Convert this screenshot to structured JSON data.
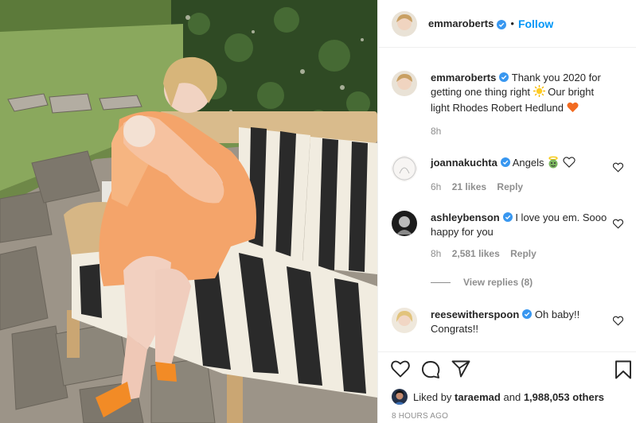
{
  "header": {
    "username": "emmaroberts",
    "separator": "•",
    "follow_label": "Follow"
  },
  "caption": {
    "username": "emmaroberts",
    "text_part1": "Thank you 2020 for getting one thing right",
    "text_part2": "Our bright light Rhodes Robert Hedlund",
    "time": "8h"
  },
  "comments": [
    {
      "username": "joannakuchta",
      "text": "Angels",
      "time": "6h",
      "likes": "21 likes",
      "reply": "Reply"
    },
    {
      "username": "ashleybenson",
      "text": "I love you em. Sooo happy for you",
      "time": "8h",
      "likes": "2,581 likes",
      "reply": "Reply"
    },
    {
      "username": "reesewitherspoon",
      "text": "Oh baby!! Congrats!!",
      "time": "",
      "likes": "",
      "reply": ""
    }
  ],
  "view_replies": "View replies (8)",
  "likes_bar": {
    "liked_by": "Liked by",
    "user": "taraemad",
    "and": "and",
    "others": "1,988,053 others"
  },
  "timestamp": "8 HOURS AGO",
  "colors": {
    "accent": "#0095f6",
    "verified": "#3897f0",
    "muted": "#8e8e8e",
    "heart_emoji": "#f26b21"
  },
  "icons": [
    "verified-badge-icon",
    "heart-icon",
    "comment-icon",
    "share-icon",
    "bookmark-icon",
    "sun-emoji-icon",
    "orange-heart-emoji-icon",
    "angel-emoji-icon",
    "white-heart-emoji-icon"
  ]
}
